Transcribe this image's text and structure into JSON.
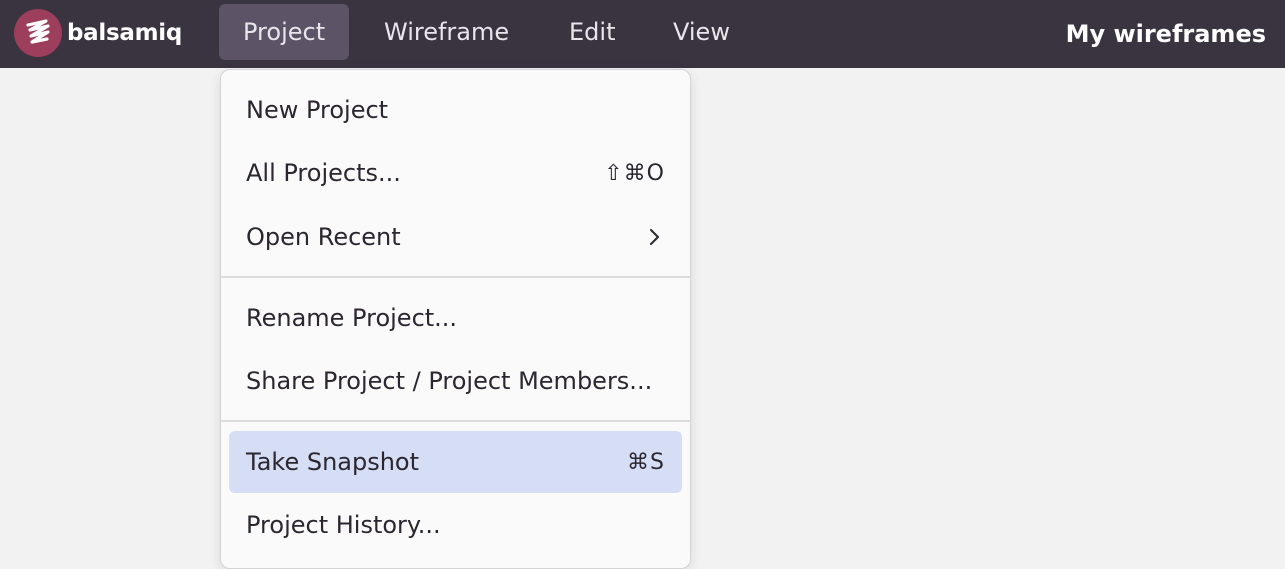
{
  "app": {
    "logo_text": "balsamiq",
    "title": "My wireframes"
  },
  "menubar": {
    "items": [
      {
        "label": "Project",
        "active": true
      },
      {
        "label": "Wireframe"
      },
      {
        "label": "Edit"
      },
      {
        "label": "View"
      }
    ]
  },
  "project_menu": {
    "items": [
      {
        "label": "New Project",
        "shortcut": ""
      },
      {
        "label": "All Projects...",
        "shortcut": "⇧⌘O"
      },
      {
        "label": "Open Recent",
        "submenu": true
      },
      {
        "label": "Rename Project..."
      },
      {
        "label": "Share Project / Project Members..."
      },
      {
        "label": "Take Snapshot",
        "shortcut": "⌘S",
        "highlighted": true
      },
      {
        "label": "Project History..."
      }
    ]
  },
  "colors": {
    "menubar_bg": "#3a3340",
    "active_menu_bg": "#5c5466",
    "logo_accent": "#9c3e5c",
    "highlight_bg": "#d6def6",
    "canvas_bg": "#f2f2f2"
  },
  "icons": {
    "logo": "balsamiq-logo-icon",
    "submenu": "chevron-right-icon"
  }
}
